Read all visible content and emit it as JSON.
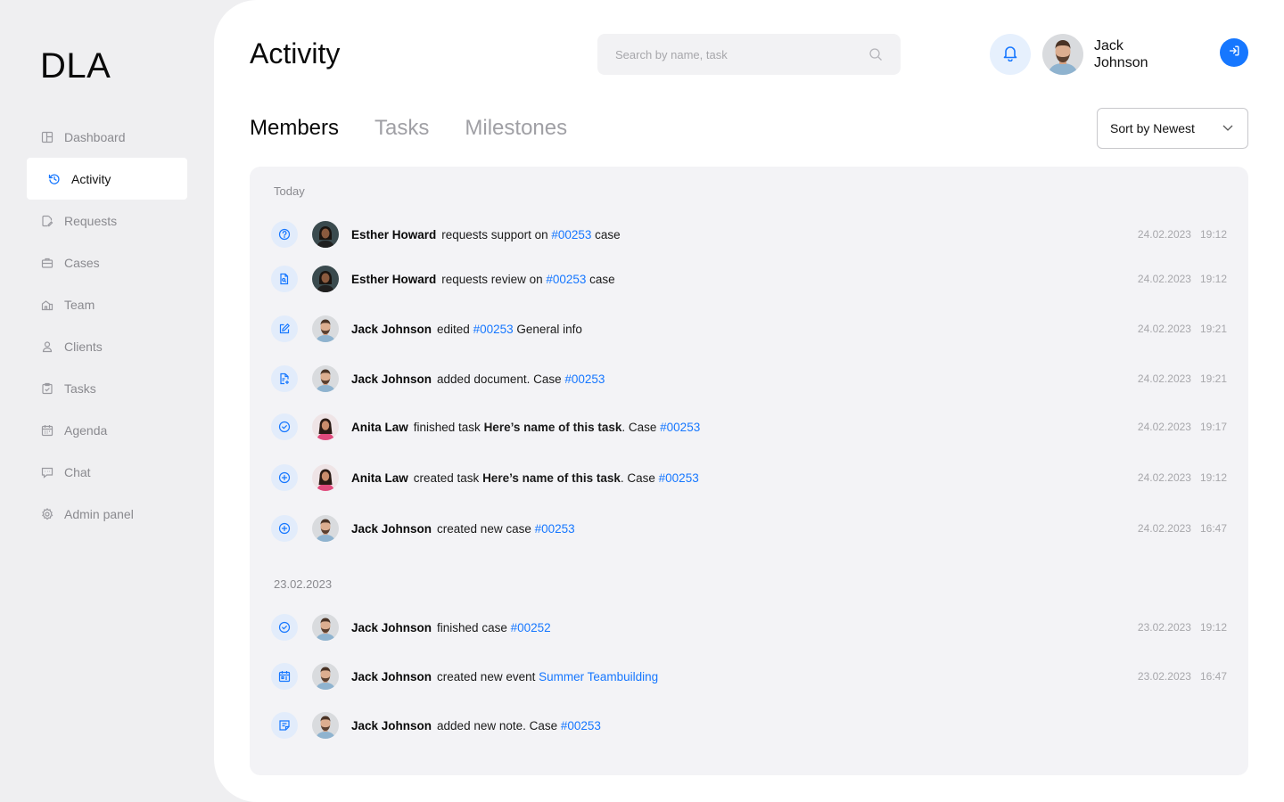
{
  "brand": {
    "logo": "DLA",
    "accent": "#1677ff"
  },
  "sidebar": {
    "items": [
      {
        "label": "Dashboard",
        "icon": "dashboard-icon"
      },
      {
        "label": "Activity",
        "icon": "history-icon",
        "active": true
      },
      {
        "label": "Requests",
        "icon": "request-icon"
      },
      {
        "label": "Cases",
        "icon": "briefcase-icon"
      },
      {
        "label": "Team",
        "icon": "team-icon"
      },
      {
        "label": "Clients",
        "icon": "user-icon"
      },
      {
        "label": "Tasks",
        "icon": "clipboard-check-icon"
      },
      {
        "label": "Agenda",
        "icon": "calendar-icon"
      },
      {
        "label": "Chat",
        "icon": "chat-icon"
      },
      {
        "label": "Admin panel",
        "icon": "gear-icon"
      }
    ]
  },
  "header": {
    "title": "Activity",
    "search": {
      "placeholder": "Search by name, task",
      "value": ""
    },
    "user": {
      "first_name": "Jack",
      "last_name": "Johnson"
    }
  },
  "tabs": [
    {
      "label": "Members",
      "active": true
    },
    {
      "label": "Tasks"
    },
    {
      "label": "Milestones"
    }
  ],
  "sort": {
    "label": "Sort by Newest"
  },
  "activity": {
    "groups": [
      {
        "label": "Today",
        "entries": [
          {
            "icon": "question-circle-icon",
            "user": "Esther Howard",
            "avatar": "esther",
            "parts": [
              {
                "t": "requests support on "
              },
              {
                "t": "#00253",
                "link": true
              },
              {
                "t": " case"
              }
            ],
            "date": "24.02.2023",
            "time": "19:12"
          },
          {
            "icon": "document-search-icon",
            "user": "Esther Howard",
            "avatar": "esther",
            "parts": [
              {
                "t": "requests review on "
              },
              {
                "t": "#00253",
                "link": true
              },
              {
                "t": " case"
              }
            ],
            "date": "24.02.2023",
            "time": "19:12"
          },
          {
            "icon": "edit-icon",
            "user": "Jack Johnson",
            "avatar": "jack",
            "parts": [
              {
                "t": "edited "
              },
              {
                "t": "#00253",
                "link": true
              },
              {
                "t": " General info"
              }
            ],
            "date": "24.02.2023",
            "time": "19:21"
          },
          {
            "icon": "document-add-icon",
            "user": "Jack Johnson",
            "avatar": "jack",
            "parts": [
              {
                "t": "added document. Case "
              },
              {
                "t": "#00253",
                "link": true
              }
            ],
            "date": "24.02.2023",
            "time": "19:21"
          },
          {
            "icon": "check-circle-icon",
            "user": "Anita Law",
            "avatar": "anita",
            "parts": [
              {
                "t": "finished task "
              },
              {
                "t": "Here’s name of this task",
                "bold": true
              },
              {
                "t": ". Case "
              },
              {
                "t": "#00253",
                "link": true
              }
            ],
            "date": "24.02.2023",
            "time": "19:17"
          },
          {
            "icon": "plus-circle-icon",
            "user": "Anita Law",
            "avatar": "anita",
            "parts": [
              {
                "t": "created task "
              },
              {
                "t": "Here’s name of this task",
                "bold": true
              },
              {
                "t": ". Case "
              },
              {
                "t": "#00253",
                "link": true
              }
            ],
            "date": "24.02.2023",
            "time": "19:12"
          },
          {
            "icon": "plus-circle-icon",
            "user": "Jack Johnson",
            "avatar": "jack",
            "parts": [
              {
                "t": "created new case "
              },
              {
                "t": "#00253",
                "link": true
              }
            ],
            "date": "24.02.2023",
            "time": "16:47"
          }
        ]
      },
      {
        "label": "23.02.2023",
        "entries": [
          {
            "icon": "check-circle-icon",
            "user": "Jack Johnson",
            "avatar": "jack",
            "parts": [
              {
                "t": "finished case "
              },
              {
                "t": "#00252",
                "link": true
              }
            ],
            "date": "23.02.2023",
            "time": "19:12"
          },
          {
            "icon": "calendar-event-icon",
            "user": "Jack Johnson",
            "avatar": "jack",
            "parts": [
              {
                "t": "created new event "
              },
              {
                "t": "Summer Teambuilding",
                "link": true
              }
            ],
            "date": "23.02.2023",
            "time": "16:47"
          },
          {
            "icon": "note-icon",
            "user": "Jack Johnson",
            "avatar": "jack",
            "parts": [
              {
                "t": "added new note. Case "
              },
              {
                "t": "#00253",
                "link": true
              }
            ],
            "date": "",
            "time": ""
          }
        ]
      }
    ]
  }
}
